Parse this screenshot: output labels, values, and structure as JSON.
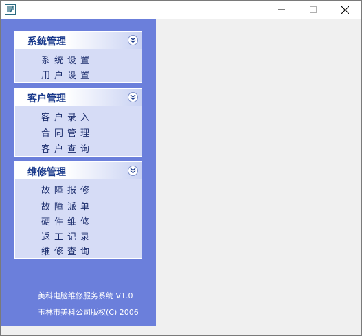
{
  "window": {
    "icon": "app-icon",
    "controls": {
      "minimize_icon": "minimize-icon",
      "maximize_icon": "maximize-icon",
      "close_icon": "close-icon"
    }
  },
  "sidebar": {
    "groups": [
      {
        "title": "系统管理",
        "items": [
          "系统设置",
          "用户设置"
        ]
      },
      {
        "title": "客户管理",
        "items": [
          "客户录入",
          "合同管理",
          "客户查询"
        ]
      },
      {
        "title": "维修管理",
        "items": [
          "故障报修",
          "故障派单",
          "硬件维修",
          "返工记录",
          "维修查询"
        ]
      }
    ],
    "footer": {
      "line1": "美科电脑维修服务系统 V1.0",
      "line2": "玉林市美科公司版权(C) 2006"
    }
  },
  "colors": {
    "sidebar_bg": "#6b7fdb",
    "group_bg": "#d6dcf6",
    "group_title": "#1a3a8c",
    "item_text": "#1e2f6e"
  }
}
